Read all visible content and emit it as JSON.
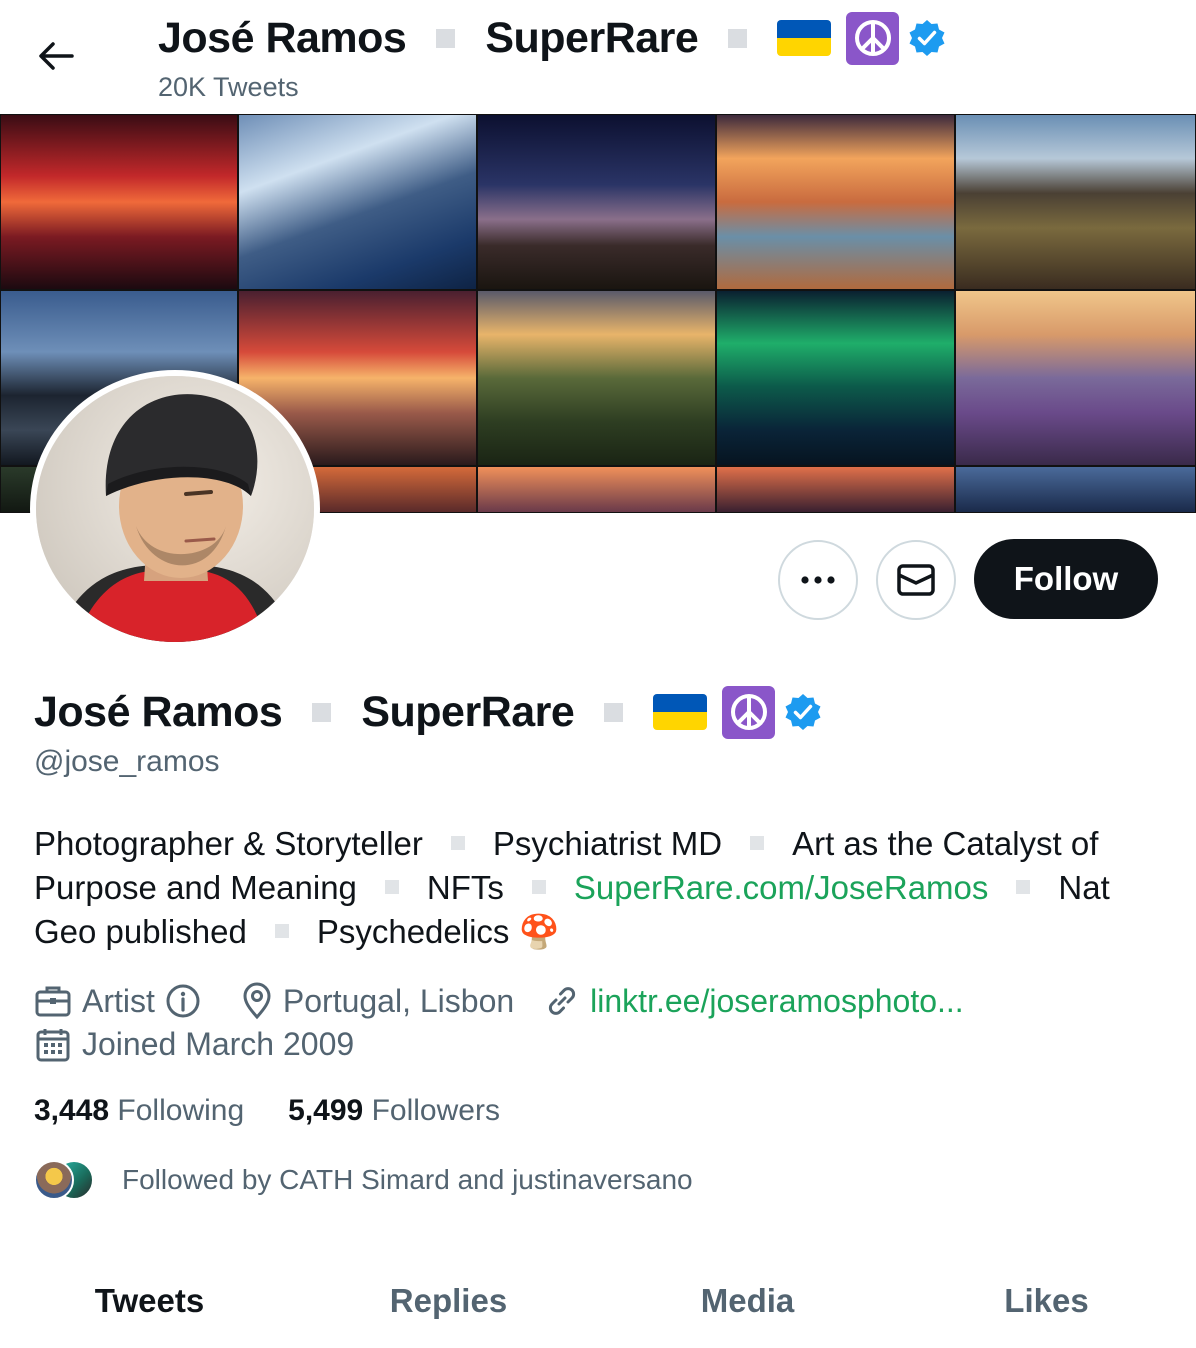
{
  "header": {
    "name_part1": "José Ramos",
    "name_part2": "SuperRare",
    "tweet_count": "20K Tweets"
  },
  "actions": {
    "follow_label": "Follow"
  },
  "profile": {
    "name_part1": "José Ramos",
    "name_part2": "SuperRare",
    "handle": "@jose_ramos",
    "bio": {
      "p1": "Photographer & Storyteller",
      "p2": "Psychiatrist MD",
      "p3": "Art as the Catalyst of Purpose and Meaning",
      "p4": "NFTs",
      "link": "SuperRare.com/JoseRamos",
      "p5": "Nat Geo published",
      "p6": "Psychedelics",
      "emoji": "🍄"
    },
    "category": "Artist",
    "location": "Portugal, Lisbon",
    "website": "linktr.ee/joseramosphoto...",
    "joined": "Joined March 2009"
  },
  "stats": {
    "following_count": "3,448",
    "following_label": "Following",
    "followers_count": "5,499",
    "followers_label": "Followers"
  },
  "followed_by": "Followed by CATH Simard and justinaversano",
  "tabs": [
    {
      "label": "Tweets"
    },
    {
      "label": "Replies"
    },
    {
      "label": "Media"
    },
    {
      "label": "Likes"
    }
  ],
  "colors": {
    "accent_link": "#1ba35a",
    "verified": "#1d9bf0",
    "follow_button": "#0f1419",
    "peace_bg": "#8a56c9"
  },
  "icons": [
    "back-arrow-icon",
    "ukraine-flag-icon",
    "peace-icon",
    "verified-badge-icon",
    "more-icon",
    "message-icon",
    "briefcase-icon",
    "info-icon",
    "location-icon",
    "link-icon",
    "calendar-icon"
  ]
}
